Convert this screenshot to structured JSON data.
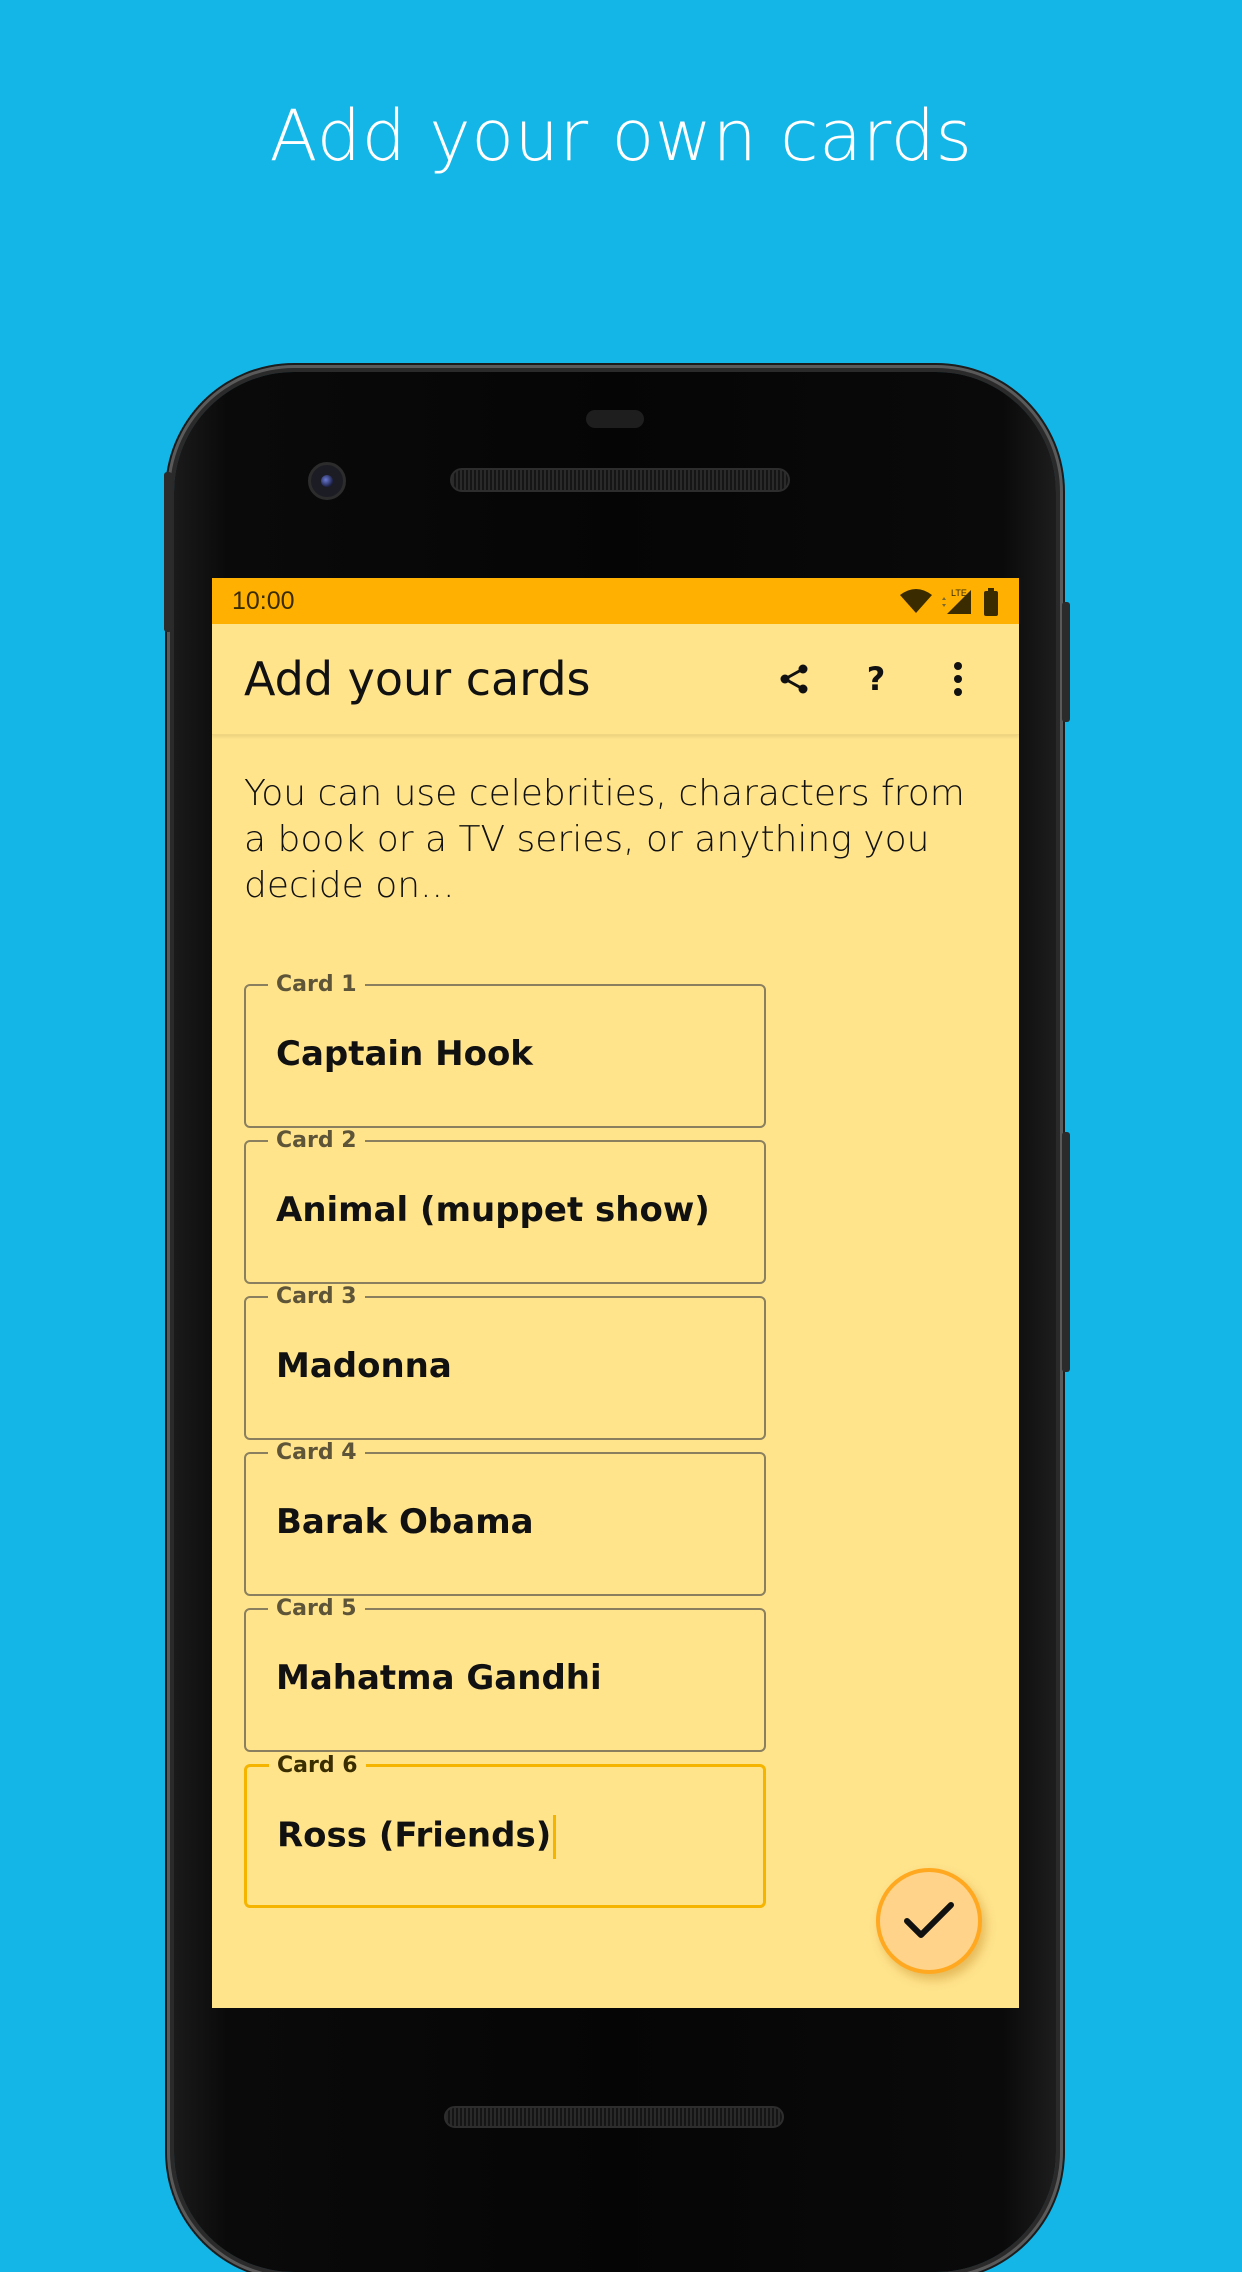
{
  "headline": "Add your own cards",
  "status_bar": {
    "time": "10:00",
    "network_label": "LTE"
  },
  "app_bar": {
    "title": "Add your cards",
    "actions": [
      "share-icon",
      "help-icon",
      "more-vert-icon"
    ],
    "help_glyph": "?"
  },
  "intro_text": "You can use celebrities, characters from a book or a TV series, or anything you decide on...",
  "cards": [
    {
      "label": "Card 1",
      "value": "Captain Hook"
    },
    {
      "label": "Card 2",
      "value": "Animal (muppet show)"
    },
    {
      "label": "Card 3",
      "value": "Madonna"
    },
    {
      "label": "Card 4",
      "value": "Barak Obama"
    },
    {
      "label": "Card 5",
      "value": "Mahatma Gandhi"
    },
    {
      "label": "Card 6",
      "value": "Ross (Friends)"
    }
  ],
  "fab": {
    "icon": "check-icon"
  },
  "colors": {
    "background": "#14b6e8",
    "screen": "#ffe48c",
    "status_bar": "#ffb000",
    "accent": "#f5b400"
  }
}
